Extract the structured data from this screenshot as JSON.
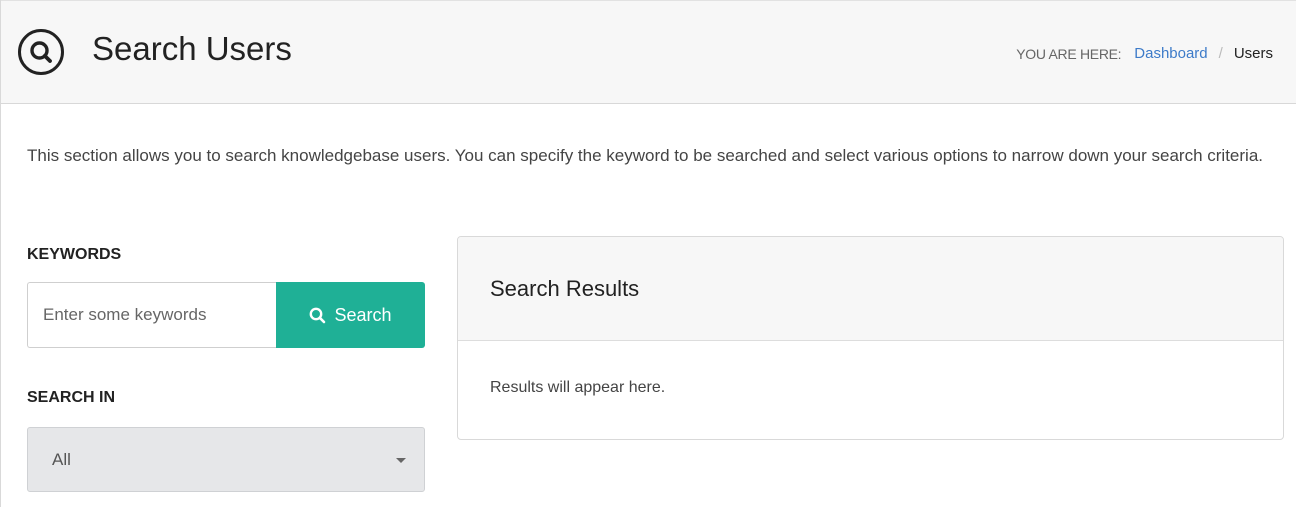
{
  "header": {
    "title": "Search Users",
    "icon": "search-icon",
    "breadcrumb": {
      "prefix": "YOU ARE HERE:",
      "items": [
        {
          "label": "Dashboard",
          "link": true
        },
        {
          "label": "Users",
          "link": false
        }
      ],
      "separator": "/"
    }
  },
  "intro": {
    "text": "This section allows you to search knowledgebase users. You can specify the keyword to be searched and select various options to narrow down your search criteria."
  },
  "search": {
    "keywords_label": "KEYWORDS",
    "input_value": "",
    "input_placeholder": "Enter some keywords",
    "button_label": "Search",
    "button_icon": "search-icon"
  },
  "search_in": {
    "label": "SEARCH IN",
    "selected": "All"
  },
  "results": {
    "title": "Search Results",
    "placeholder_text": "Results will appear here."
  },
  "colors": {
    "accent": "#1fb096",
    "link": "#3d7bc9",
    "header_bg": "#f7f7f7"
  }
}
